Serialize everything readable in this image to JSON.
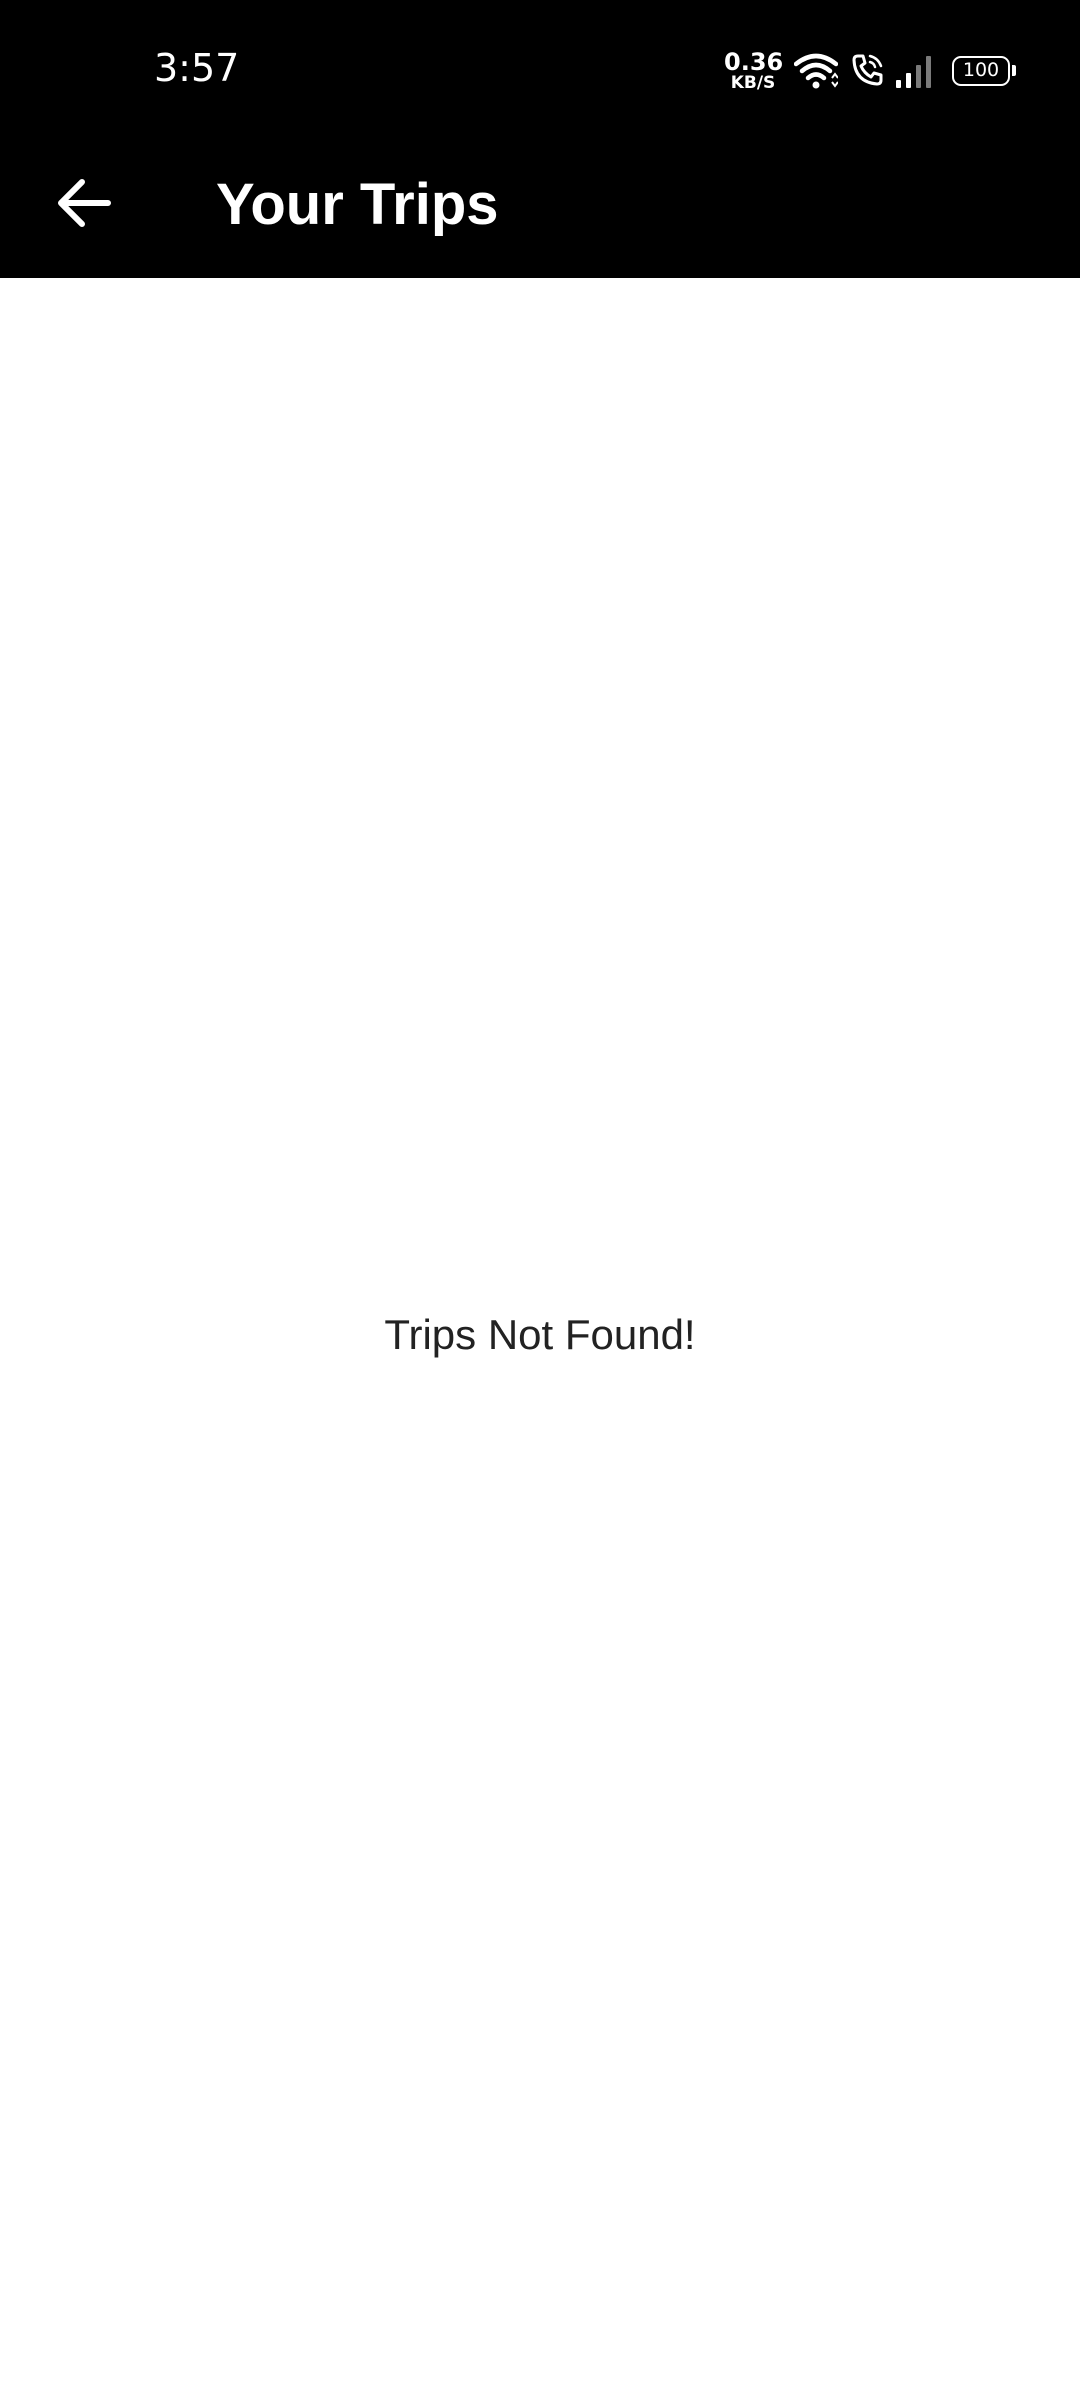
{
  "status_bar": {
    "time": "3:57",
    "net_speed_value": "0.36",
    "net_speed_unit": "KB/S",
    "battery_level": "100",
    "icons": [
      "wifi-icon",
      "wifi-call-icon",
      "signal-icon",
      "battery-icon"
    ]
  },
  "app_bar": {
    "back_icon": "arrow-left-icon",
    "title": "Your Trips"
  },
  "content": {
    "empty_message": "Trips Not Found!"
  },
  "colors": {
    "app_bar_background": "#000000",
    "app_bar_text": "#ffffff",
    "content_background": "#ffffff",
    "body_text": "#222222"
  }
}
